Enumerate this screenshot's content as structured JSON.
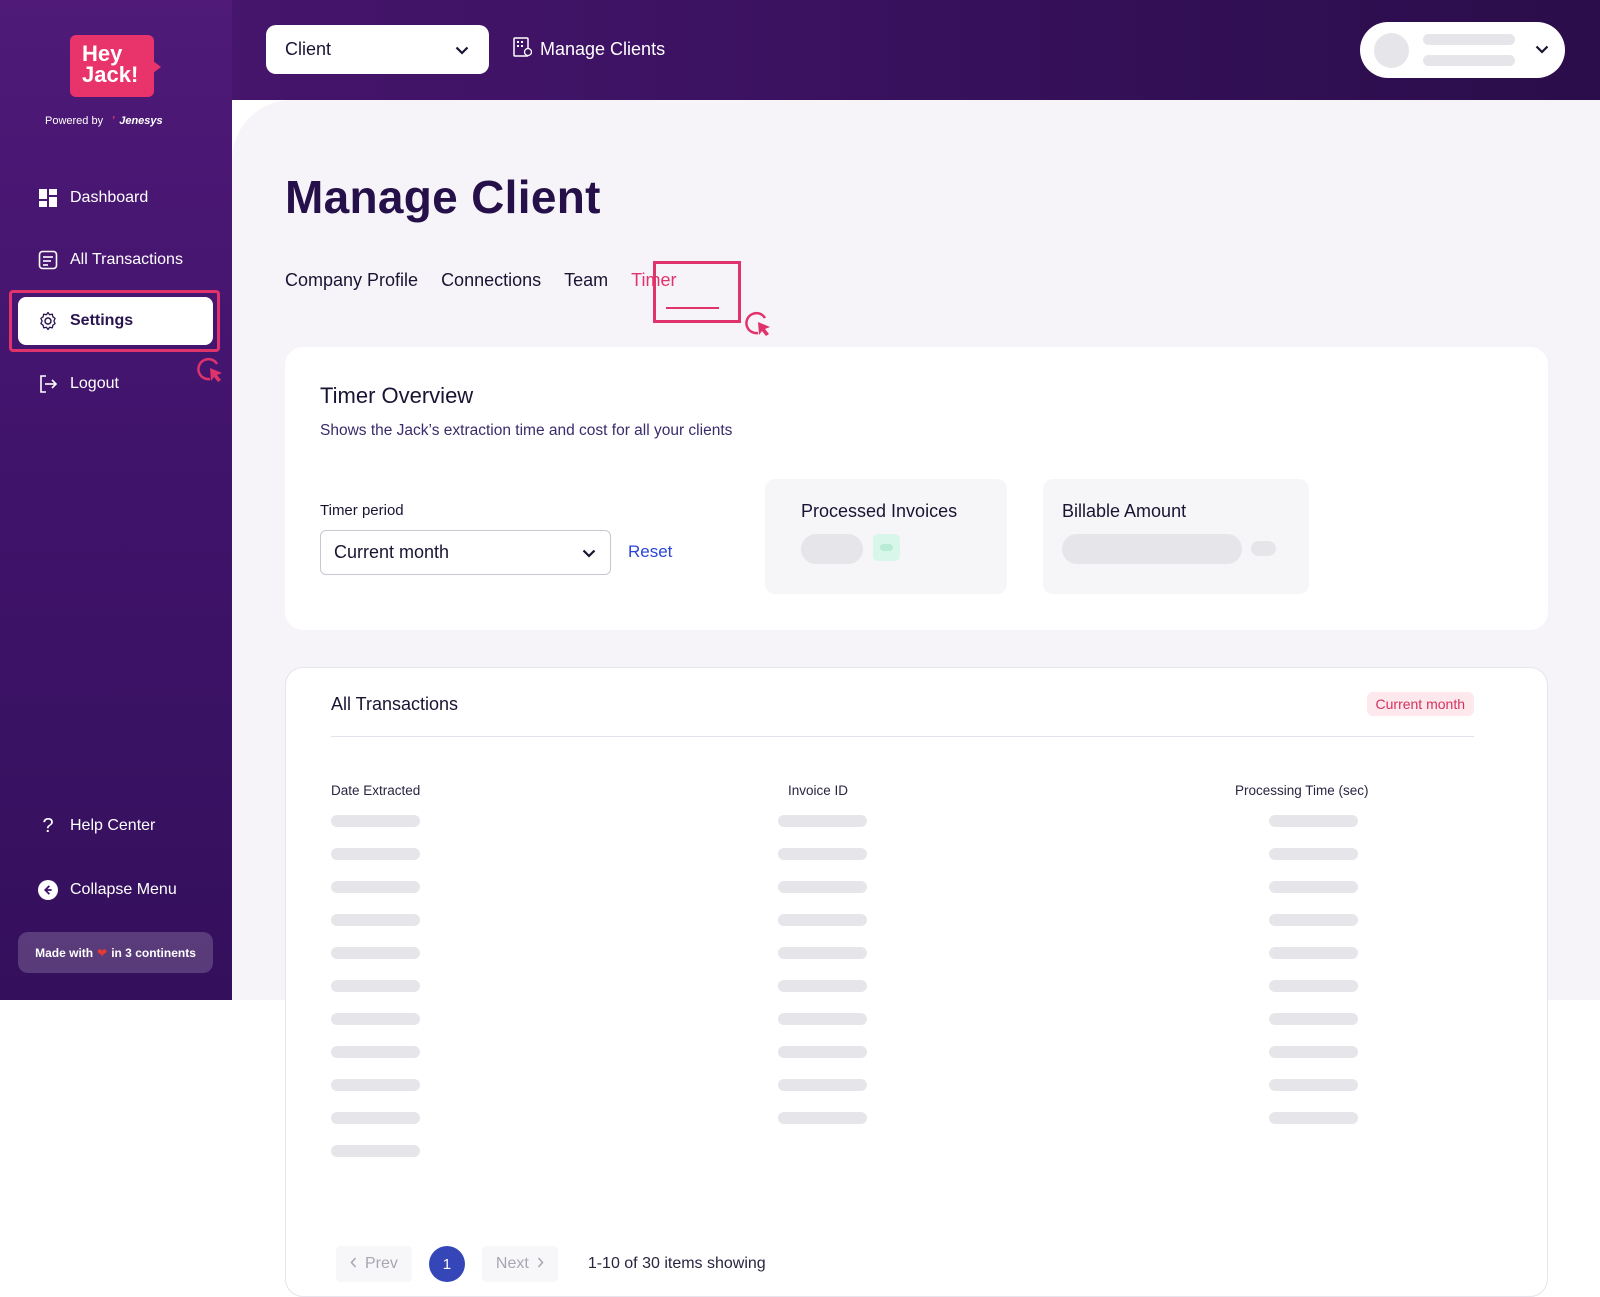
{
  "logo": {
    "line1": "Hey",
    "line2": "Jack!",
    "powered_by": "Powered by",
    "brand": "Jenesys"
  },
  "sidebar": {
    "items": [
      {
        "label": "Dashboard",
        "icon": "dashboard-icon"
      },
      {
        "label": "All Transactions",
        "icon": "transactions-icon"
      },
      {
        "label": "Settings",
        "icon": "gear-icon",
        "active": true
      },
      {
        "label": "Logout",
        "icon": "logout-icon"
      }
    ],
    "help": "Help Center",
    "collapse": "Collapse Menu",
    "made_with": {
      "prefix": "Made with",
      "suffix": "in  3 continents"
    }
  },
  "header": {
    "client_select": "Client",
    "manage_clients": "Manage Clients"
  },
  "page": {
    "title": "Manage Client",
    "tabs": [
      "Company Profile",
      "Connections",
      "Team",
      "Timer"
    ],
    "active_tab": "Timer"
  },
  "timer": {
    "title": "Timer Overview",
    "subtitle": "Shows the Jack’s extraction time and cost for all your clients",
    "period_label": "Timer period",
    "period_value": "Current month",
    "reset": "Reset",
    "processed_invoices": "Processed Invoices",
    "billable_amount": "Billable Amount"
  },
  "transactions": {
    "title": "All Transactions",
    "badge": "Current month",
    "columns": [
      "Date Extracted",
      "Invoice ID",
      "Processing Time (sec)"
    ],
    "pagination": {
      "prev": "Prev",
      "page": "1",
      "next": "Next",
      "info": "1-10 of 30 items showing"
    }
  },
  "colors": {
    "accent": "#e0336b",
    "primary": "#3446b8",
    "sidebar": "#3f136a",
    "link": "#2b44d8"
  }
}
